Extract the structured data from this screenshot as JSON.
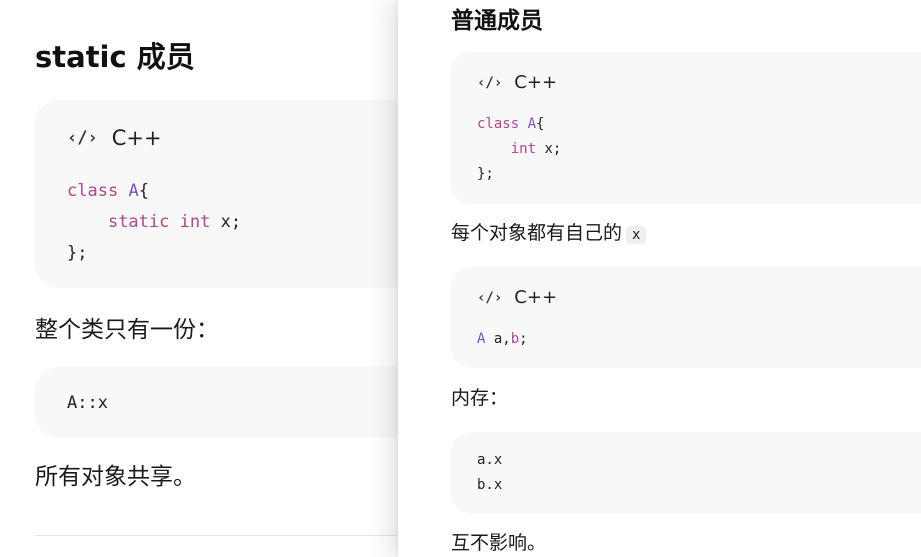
{
  "left": {
    "heading": "static 成员",
    "code1": {
      "icon": "code-icon",
      "language": "C++",
      "l1_kw": "class",
      "l1_cls": "A",
      "l1_rest": "{",
      "l2_indent": "    ",
      "l2_kw1": "static",
      "l2_kw2": "int",
      "l2_rest": " x;",
      "l3": "};"
    },
    "text1": "整个类只有一份：",
    "code2_line": "A::x",
    "text2": "所有对象共享。"
  },
  "right": {
    "heading": "普通成员",
    "code1": {
      "icon": "code-icon",
      "language": "C++",
      "l1_kw": "class",
      "l1_cls": "A",
      "l1_rest": "{",
      "l2_indent": "    ",
      "l2_kw": "int",
      "l2_rest": " x;",
      "l3": "};"
    },
    "text1_prefix": "每个对象都有自己的",
    "text1_code": "x",
    "code2": {
      "icon": "code-icon",
      "language": "C++",
      "l1_cls": "A",
      "l1_mid": " a,",
      "l1_b": "b",
      "l1_end": ";"
    },
    "text2": "内存：",
    "code3_l1": "a.x",
    "code3_l2": "b.x",
    "text3": "互不影响。"
  },
  "colors": {
    "keyword": "#a74a8e",
    "class_name": "#7a54b5",
    "code_bg": "#f8f8f8"
  }
}
